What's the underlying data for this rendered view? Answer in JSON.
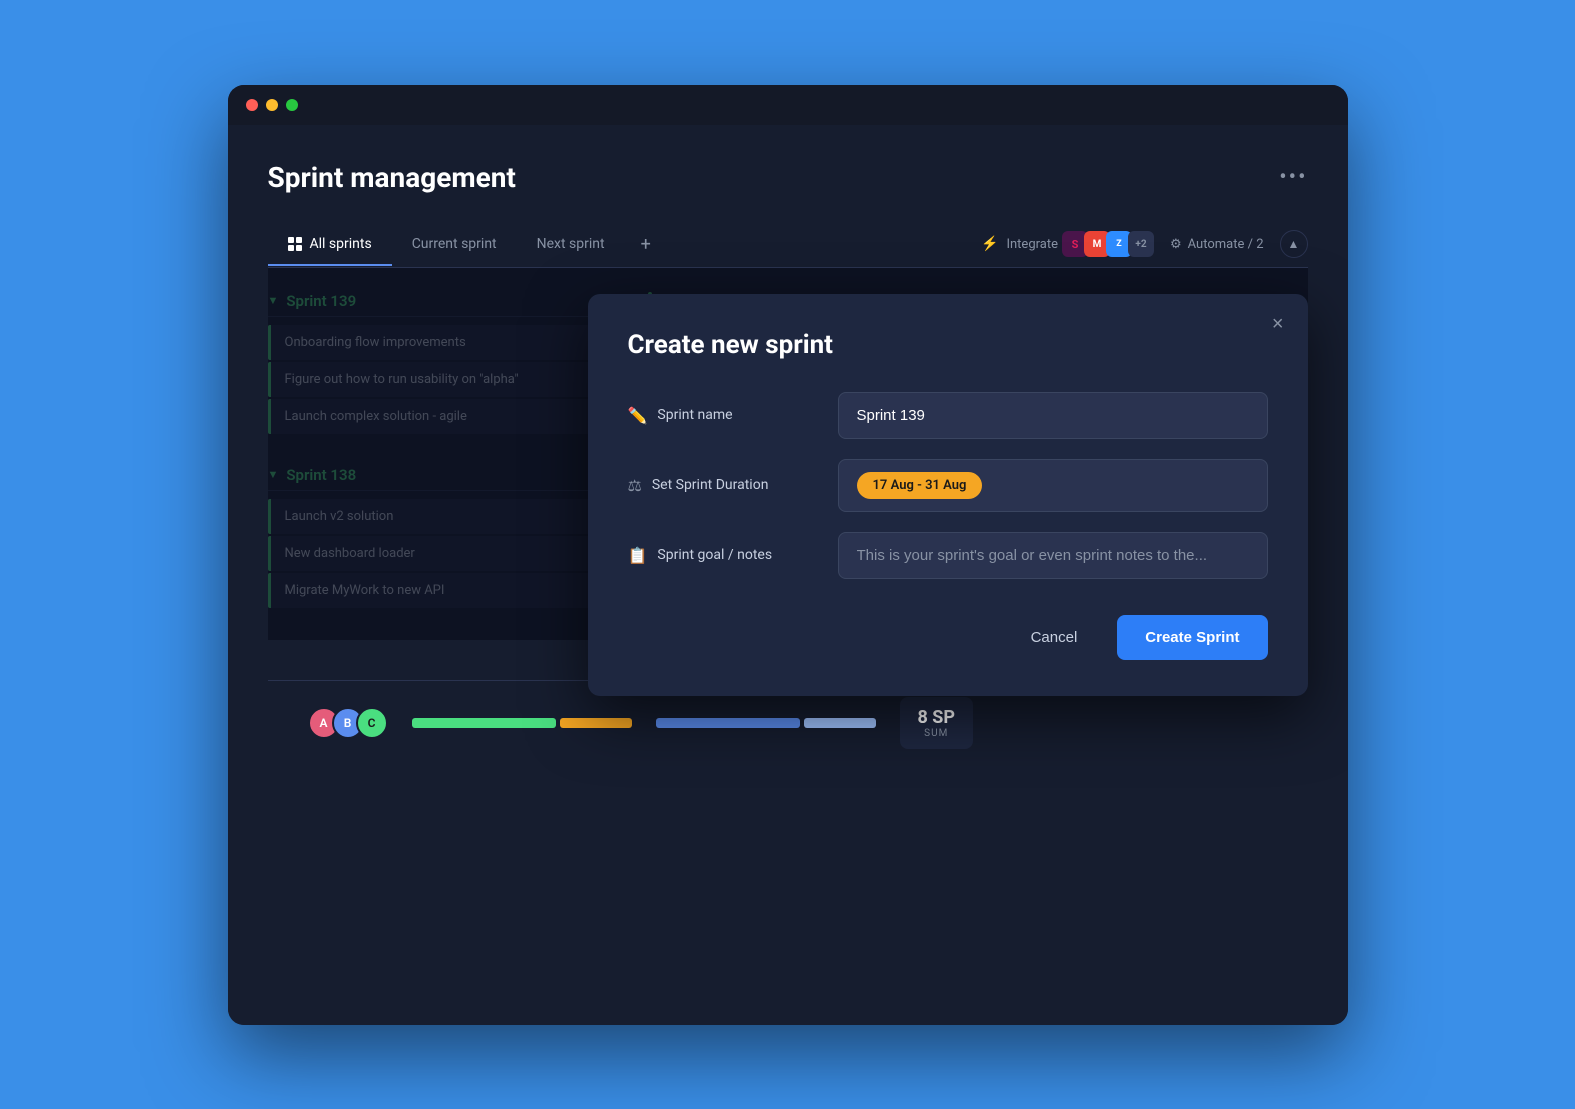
{
  "app": {
    "title": "Sprint management",
    "more_icon": "•••"
  },
  "tabs": {
    "items": [
      {
        "label": "All sprints",
        "active": true,
        "has_icon": true
      },
      {
        "label": "Current sprint",
        "active": false
      },
      {
        "label": "Next sprint",
        "active": false
      }
    ],
    "add_label": "+",
    "integrate_label": "Integrate",
    "automate_label": "Automate / 2"
  },
  "sprints": [
    {
      "name": "Sprint 139",
      "items": [
        "Onboarding flow improvements",
        "Figure out how to run usability on \"alpha\"",
        "Launch complex solution - agile"
      ]
    },
    {
      "name": "Sprint 138",
      "items": [
        "Launch v2 solution",
        "New dashboard loader",
        "Migrate MyWork to new API"
      ]
    }
  ],
  "modal": {
    "title": "Create new sprint",
    "fields": {
      "sprint_name_label": "Sprint name",
      "sprint_name_value": "Sprint 139",
      "sprint_name_placeholder": "Sprint 139",
      "duration_label": "Set Sprint Duration",
      "duration_value": "17 Aug - 31 Aug",
      "goal_label": "Sprint goal / notes",
      "goal_placeholder": "This is your sprint's goal or even sprint notes to the..."
    },
    "buttons": {
      "cancel": "Cancel",
      "create": "Create Sprint"
    },
    "close_icon": "×"
  },
  "bottom_bar": {
    "sp_number": "8 SP",
    "sp_label": "SUM"
  }
}
